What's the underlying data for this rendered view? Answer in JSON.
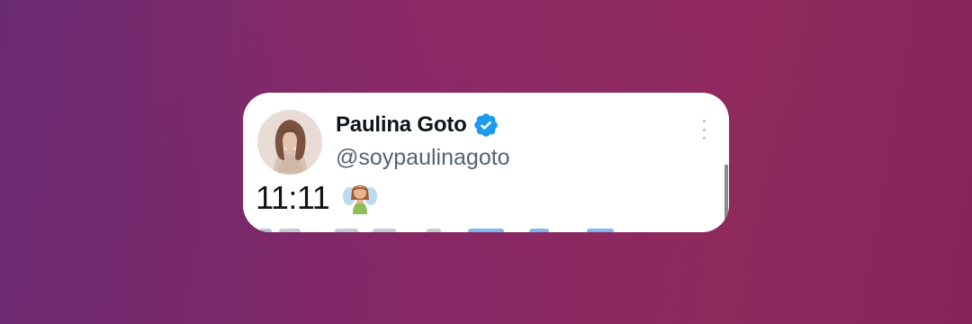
{
  "tweet": {
    "display_name": "Paulina Goto",
    "handle": "@soypaulinagoto",
    "verified": true,
    "text": "11:11",
    "emoji": "fairy-emoji"
  },
  "colors": {
    "background_start": "#6a2a72",
    "background_end": "#8e2a5c",
    "card": "#ffffff",
    "verified_badge": "#1d9bf0",
    "name": "#0f1419",
    "handle": "#536471"
  },
  "icons": {
    "verified": "verified-badge-icon",
    "more": "more-options-icon"
  }
}
